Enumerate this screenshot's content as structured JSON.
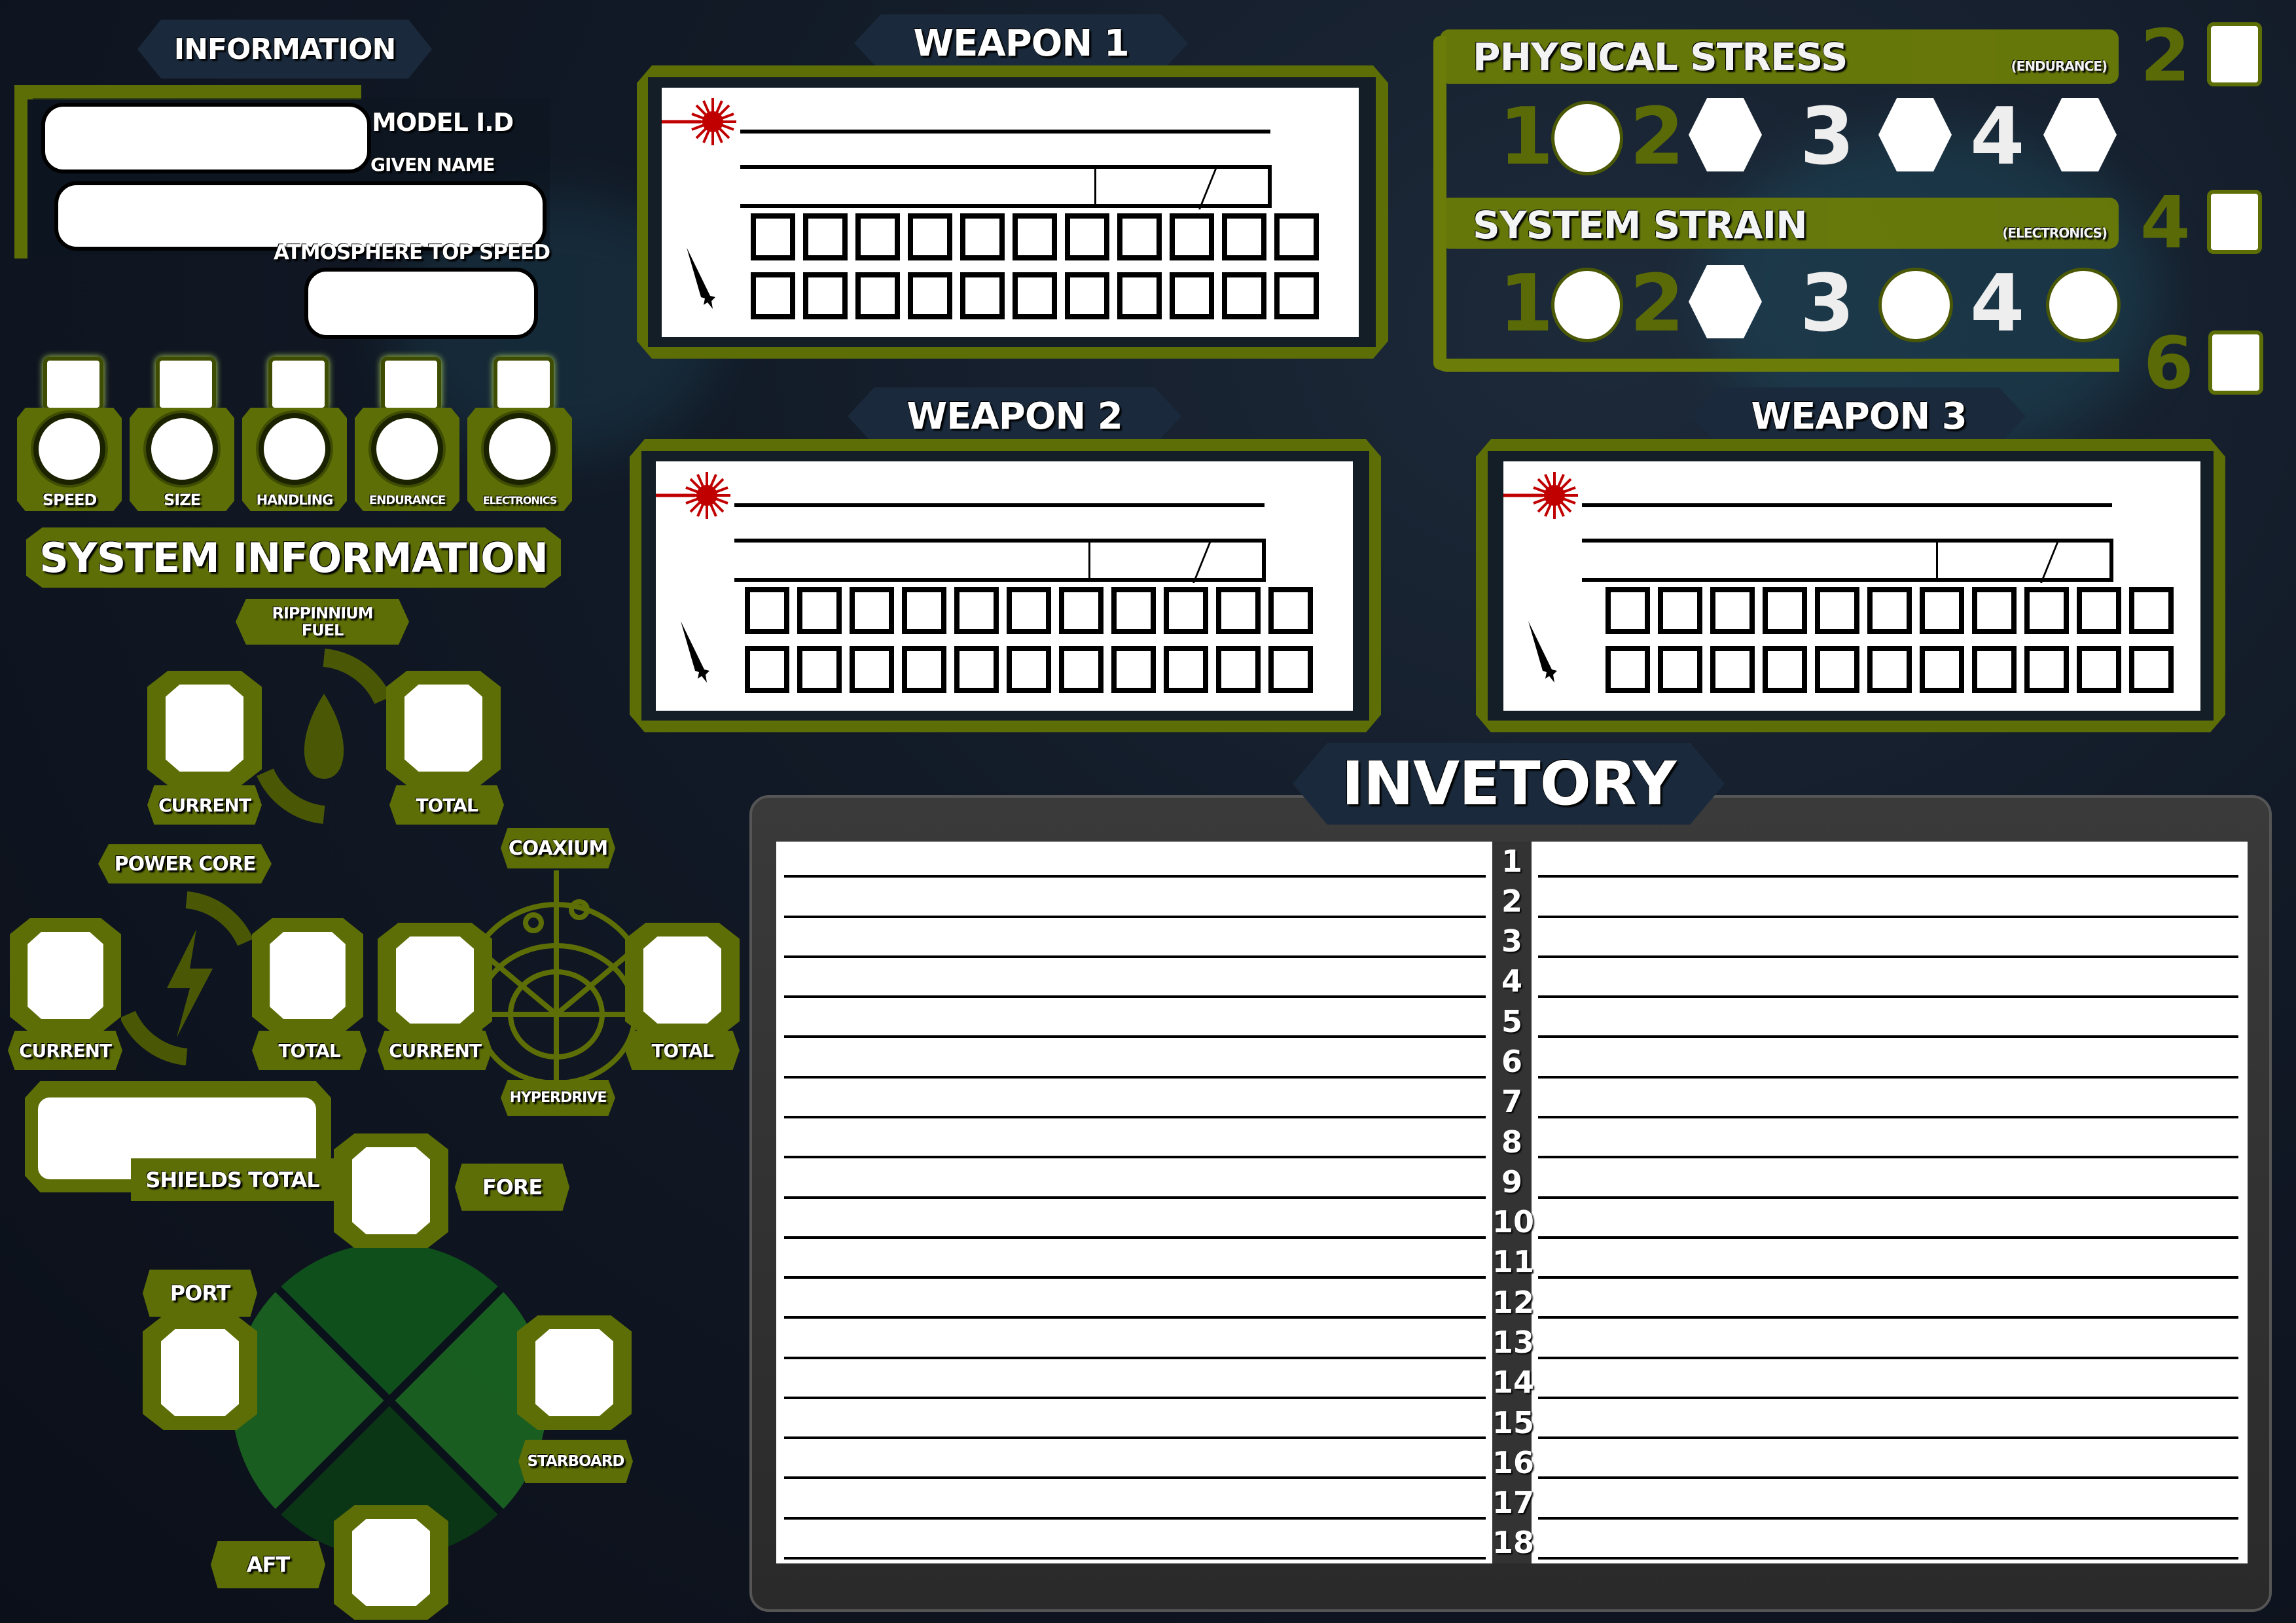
{
  "information": {
    "title": "INFORMATION",
    "model_id_label": "MODEL I.D",
    "model_id_value": "",
    "given_name_label": "GIVEN NAME",
    "given_name_value": "",
    "atmosphere_top_speed_label": "ATMOSPHERE TOP SPEED",
    "atmosphere_top_speed_value": ""
  },
  "stats": [
    {
      "label": "SPEED",
      "value": "",
      "modifier": ""
    },
    {
      "label": "SIZE",
      "value": "",
      "modifier": ""
    },
    {
      "label": "HANDLING",
      "value": "",
      "modifier": ""
    },
    {
      "label": "ENDURANCE",
      "value": "",
      "modifier": ""
    },
    {
      "label": "ELECTRONICS",
      "value": "",
      "modifier": ""
    }
  ],
  "system_information": {
    "title": "SYSTEM INFORMATION",
    "fuel": {
      "label_line1": "RIPPINNIUM",
      "label_line2": "FUEL",
      "current_label": "CURRENT",
      "total_label": "TOTAL",
      "current": "",
      "total": ""
    },
    "power_core": {
      "label": "POWER CORE",
      "current_label": "CURRENT",
      "total_label": "TOTAL",
      "current": "",
      "total": ""
    },
    "coaxium": {
      "label": "COAXIUM",
      "sublabel": "HYPERDRIVE",
      "current_label": "CURRENT",
      "total_label": "TOTAL",
      "current": "",
      "total": ""
    },
    "shields": {
      "total_label": "SHIELDS TOTAL",
      "total": "",
      "fore_label": "FORE",
      "fore": "",
      "port_label": "PORT",
      "port": "",
      "starboard_label": "STARBOARD",
      "starboard": "",
      "aft_label": "AFT",
      "aft": ""
    }
  },
  "weapons": [
    {
      "title": "WEAPON 1",
      "name": "",
      "type": "",
      "ammo_current": "",
      "ammo_max": "",
      "ammo_slots": 22
    },
    {
      "title": "WEAPON 2",
      "name": "",
      "type": "",
      "ammo_current": "",
      "ammo_max": "",
      "ammo_slots": 22
    },
    {
      "title": "WEAPON 3",
      "name": "",
      "type": "",
      "ammo_current": "",
      "ammo_max": "",
      "ammo_slots": 22
    }
  ],
  "physical_stress": {
    "title": "PHYSICAL STRESS",
    "subtitle": "(ENDURANCE)",
    "levels": [
      {
        "number": "1",
        "shape": "circle"
      },
      {
        "number": "2",
        "shape": "hexagon"
      },
      {
        "number": "3",
        "shape": "hexagon"
      },
      {
        "number": "4",
        "shape": "hexagon"
      }
    ]
  },
  "system_strain": {
    "title": "SYSTEM STRAIN",
    "subtitle": "(ELECTRONICS)",
    "levels": [
      {
        "number": "1",
        "shape": "circle"
      },
      {
        "number": "2",
        "shape": "hexagon"
      },
      {
        "number": "3",
        "shape": "circle"
      },
      {
        "number": "4",
        "shape": "circle"
      }
    ]
  },
  "thresholds": [
    {
      "number": "2",
      "value": ""
    },
    {
      "number": "4",
      "value": ""
    },
    {
      "number": "6",
      "value": ""
    }
  ],
  "inventory": {
    "title": "INVETORY",
    "rows": [
      "1",
      "2",
      "3",
      "4",
      "5",
      "6",
      "7",
      "8",
      "9",
      "10",
      "11",
      "12",
      "13",
      "14",
      "15",
      "16",
      "17",
      "18"
    ]
  },
  "colors": {
    "accent_olive": "#5d6e06",
    "laser_red": "#c00000",
    "shield_green": "#0f4a1a",
    "background_navy": "#121a27"
  }
}
